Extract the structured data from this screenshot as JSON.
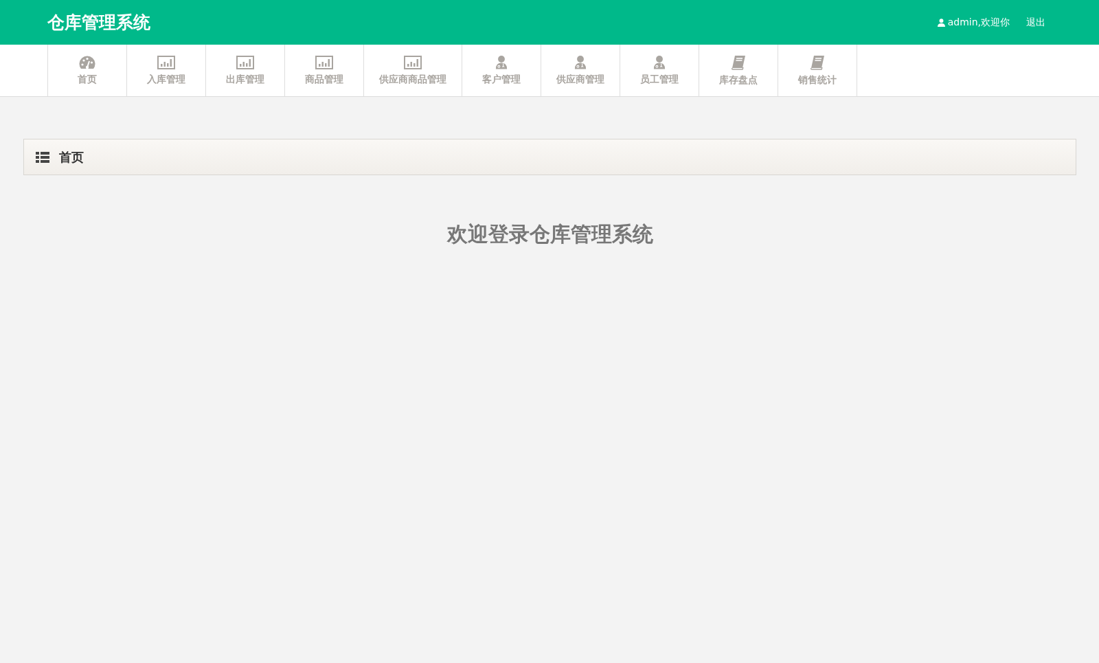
{
  "header": {
    "title": "仓库管理系统",
    "user": "admin,欢迎你",
    "logout": "退出"
  },
  "nav": [
    {
      "label": "首页",
      "kind": "dashboard"
    },
    {
      "label": "入库管理",
      "kind": "chart"
    },
    {
      "label": "出库管理",
      "kind": "chart"
    },
    {
      "label": "商品管理",
      "kind": "chart"
    },
    {
      "label": "供应商商品管理",
      "kind": "chart"
    },
    {
      "label": "客户管理",
      "kind": "person"
    },
    {
      "label": "供应商管理",
      "kind": "person"
    },
    {
      "label": "员工管理",
      "kind": "person"
    },
    {
      "label": "库存盘点",
      "kind": "book"
    },
    {
      "label": "销售统计",
      "kind": "book"
    }
  ],
  "breadcrumb": "首页",
  "welcome": "欢迎登录仓库管理系统"
}
